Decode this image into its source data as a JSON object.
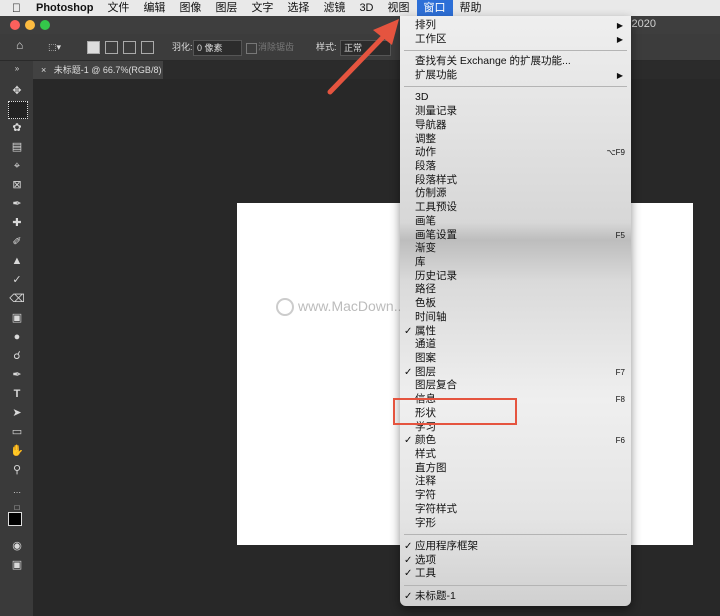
{
  "menubar": {
    "app": "Photoshop",
    "items": [
      "文件",
      "编辑",
      "图像",
      "图层",
      "文字",
      "选择",
      "滤镜",
      "3D",
      "视图",
      "窗口",
      "帮助"
    ]
  },
  "window": {
    "title_fragment": "2020"
  },
  "options": {
    "feather_label": "羽化:",
    "feather_value": "0 像素",
    "antialias_label": "消除锯齿",
    "style_label": "样式:",
    "style_value": "正常"
  },
  "document": {
    "tab_title": "未标题-1 @ 66.7%(RGB/8)"
  },
  "watermark": "www.MacDown...",
  "window_menu": {
    "items": [
      {
        "label": "排列",
        "submenu": true
      },
      {
        "label": "工作区",
        "submenu": true
      },
      {
        "label": "查找有关 Exchange 的扩展功能..."
      },
      {
        "label": "扩展功能",
        "submenu": true
      },
      {
        "label": "3D"
      },
      {
        "label": "测量记录"
      },
      {
        "label": "导航器"
      },
      {
        "label": "调整"
      },
      {
        "label": "动作",
        "shortcut": "⌥F9"
      },
      {
        "label": "段落"
      },
      {
        "label": "段落样式"
      },
      {
        "label": "仿制源"
      },
      {
        "label": "工具预设"
      },
      {
        "label": "画笔"
      },
      {
        "label": "画笔设置",
        "shortcut": "F5"
      },
      {
        "label": "渐变"
      },
      {
        "label": "库"
      },
      {
        "label": "历史记录"
      },
      {
        "label": "路径"
      },
      {
        "label": "色板"
      },
      {
        "label": "时间轴"
      },
      {
        "label": "属性",
        "checked": true
      },
      {
        "label": "通道"
      },
      {
        "label": "图案"
      },
      {
        "label": "图层",
        "checked": true,
        "shortcut": "F7"
      },
      {
        "label": "图层复合"
      },
      {
        "label": "信息",
        "shortcut": "F8"
      },
      {
        "label": "形状"
      },
      {
        "label": "学习"
      },
      {
        "label": "颜色",
        "checked": true,
        "shortcut": "F6"
      },
      {
        "label": "样式"
      },
      {
        "label": "直方图"
      },
      {
        "label": "注释"
      },
      {
        "label": "字符"
      },
      {
        "label": "字符样式"
      },
      {
        "label": "字形"
      },
      {
        "label": "应用程序框架",
        "checked": true
      },
      {
        "label": "选项",
        "checked": true
      },
      {
        "label": "工具",
        "checked": true
      },
      {
        "label": "未标题-1",
        "checked": true
      }
    ]
  },
  "colors": {
    "accent": "#2d6fd7",
    "highlight_box": "#e5543f",
    "arrow": "#e5543f"
  }
}
